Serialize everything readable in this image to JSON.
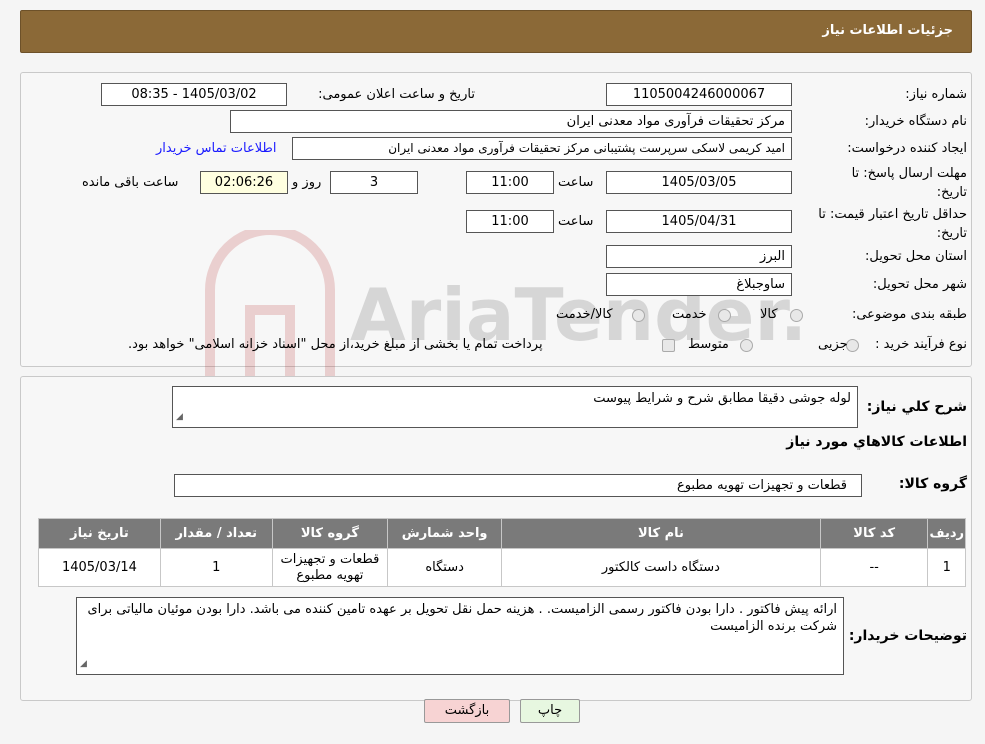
{
  "header": {
    "title": "جزئیات اطلاعات نیاز"
  },
  "form": {
    "need_number_label": "شماره نیاز:",
    "need_number": "1105004246000067",
    "announce_label": "تاریخ و ساعت اعلان عمومی:",
    "announce_value": "1405/03/02 - 08:35",
    "buyer_org_label": "نام دستگاه خریدار:",
    "buyer_org": "مرکز تحقیقات فرآوری مواد معدنی ایران",
    "creator_label": "ایجاد کننده درخواست:",
    "creator": "امید کریمی لاسکی سرپرست پشتیبانی مرکز تحقیقات فرآوری مواد معدنی ایران",
    "contact_link": "اطلاعات تماس خریدار",
    "deadline_label": "مهلت ارسال پاسخ: تا تاریخ:",
    "deadline_date": "1405/03/05",
    "time_label": "ساعت",
    "deadline_time": "11:00",
    "days": "3",
    "days_label": "روز و",
    "remaining": "02:06:26",
    "remaining_label": "ساعت باقی مانده",
    "price_validity_label": "حداقل تاریخ اعتبار قیمت: تا تاریخ:",
    "price_validity_date": "1405/04/31",
    "price_validity_time": "11:00",
    "province_label": "استان محل تحویل:",
    "province": "البرز",
    "city_label": "شهر محل تحویل:",
    "city": "ساوجبلاغ",
    "category_label": "طبقه بندی موضوعی:",
    "category_options": [
      "کالا",
      "خدمت",
      "کالا/خدمت"
    ],
    "process_label": "نوع فرآیند خرید :",
    "process_options": [
      "جزیی",
      "متوسط"
    ],
    "process_note": "پرداخت تمام یا بخشی از مبلغ خرید،از محل \"اسناد خزانه اسلامی\" خواهد بود."
  },
  "summary": {
    "label": "شرح کلي نياز:",
    "value": "لوله  جوشی دقیقا مطابق شرح و شرایط پیوست"
  },
  "goods": {
    "section_title": "اطلاعات کالاهاي مورد نياز",
    "group_label": "گروه کالا:",
    "group_value": "قطعات و تجهیزات تهویه مطبوع",
    "columns": [
      "رديف",
      "کد کالا",
      "نام کالا",
      "واحد شمارش",
      "گروه کالا",
      "تعداد / مقدار",
      "تاريخ نياز"
    ],
    "rows": [
      [
        "1",
        "--",
        "دستگاه داست کالکتور",
        "دستگاه",
        "قطعات و تجهیزات تهویه مطبوع",
        "1",
        "1405/03/14"
      ]
    ]
  },
  "buyer_notes": {
    "label": "توضیحات خریدار:",
    "value": "ارائه پیش فاکتور . دارا بودن فاکتور رسمی الزامیست. . هزینه حمل نقل تحویل بر عهده تامین کننده می باشد. دارا بودن موئیان مالیاتی برای شرکت برنده الزامیست"
  },
  "buttons": {
    "print": "چاپ",
    "back": "بازگشت"
  },
  "watermark": {
    "text": "AriaTender.neT"
  },
  "colors": {
    "header": "#8b6937",
    "link": "#1a1aff",
    "back_button": "#f7d3d3",
    "print_button": "#e7f7e0",
    "table_header": "#7a7a7a"
  }
}
